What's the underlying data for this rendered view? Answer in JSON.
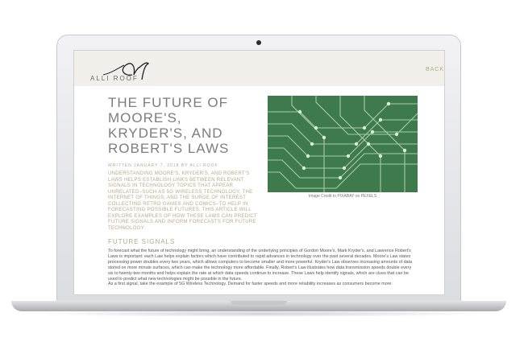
{
  "site": {
    "logo_text": "ALLI ROOF",
    "back_label": "BACK"
  },
  "article": {
    "title": "THE FUTURE OF MOORE'S, KRYDER'S, AND ROBERT'S LAWS",
    "byline": "WRITTEN JANUARY 7, 2018 BY ALLI ROOF",
    "lead": "UNDERSTANDING MOORE'S, KRYDER'S, AND ROBERT'S LAWS HELPS ESTABLISH LINKS BETWEEN RELEVANT SIGNALS IN TECHNOLOGY TOPICS THAT APPEAR UNRELATED–SUCH AS 5G WIRELESS TECHNOLOGY, THE INTERNET OF THINGS, AND THE SURGE OF INTEREST COLLECTING RETRO GAMES AND COMICS–TO HELP IN FORECASTING POSSIBLE FUTURES. THIS ARTICLE WILL EXPLORE EXAMPLES OF HOW THESE LAWS CAN PREDICT FUTURE SIGNALS AND INFORM FORECASTS FOR FUTURE TECHNOLOGY.",
    "image_caption": "Image Credit to PIXABAY on PEXELS",
    "section_title": "FUTURE SIGNALS",
    "paragraph1": "To forecast what the future of technology might bring, an understanding of the underlying principles of Gordon Moore's, Mark Kryder's, and Lawrence Robert's Laws is important: each Law helps explain factors which have contributed to rapid advances in technology over the past several decades. Moore's Law states processing power doubles every two years, which allows computers to become smaller and more powerful. Kryder's Law observes increasing amounts of data stored on more minute surfaces, which can make the technology more affordable. Finally, Robert's Law illustrates how data transmission speeds double every six to twenty-two months and helps explain the rate at which data speeds continue to increase. These Laws help identify signals, which are clues that can be used to predict what new technologies might be possible in the future.",
    "paragraph2": "As a first signal, take the example of 5G Wireless Technology. Demand for faster speeds and more reliability increases as consumers become more"
  },
  "colors": {
    "accent": "#b7a88d",
    "header_bg": "#f1efe9",
    "title": "#7d7d7d",
    "circuit_green": "#3f7a4c"
  }
}
